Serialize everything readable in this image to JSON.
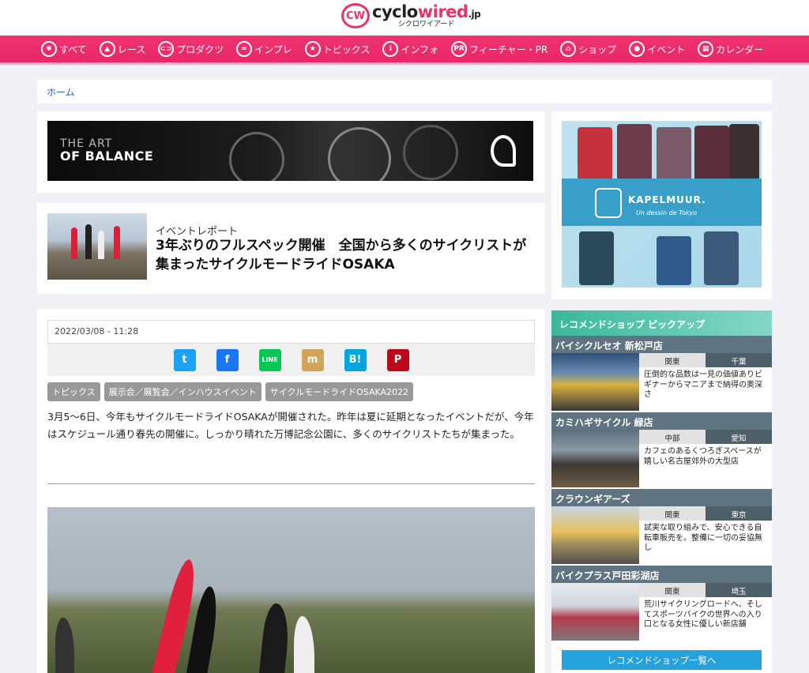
{
  "header": {
    "logo_mark": "CW",
    "logo_pre": "cyclo",
    "logo_accent": "wired",
    "logo_suffix": ".jp",
    "logo_sub": "シクロワイアード"
  },
  "nav": [
    {
      "label": "すべて",
      "icon": "star-icon",
      "glyph": "✱"
    },
    {
      "label": "レース",
      "icon": "race-icon",
      "glyph": "▲"
    },
    {
      "label": "プロダクツ",
      "icon": "products-icon",
      "glyph": "⊂⊃"
    },
    {
      "label": "インプレ",
      "icon": "impression-icon",
      "glyph": "∞"
    },
    {
      "label": "トピックス",
      "icon": "topics-icon",
      "glyph": "★"
    },
    {
      "label": "インフォ",
      "icon": "info-icon",
      "glyph": "i"
    },
    {
      "label": "フィーチャー・PR",
      "icon": "pr-icon",
      "glyph": "PR"
    },
    {
      "label": "ショップ",
      "icon": "shop-icon",
      "glyph": "⌂"
    },
    {
      "label": "イベント",
      "icon": "event-pin-icon",
      "glyph": "●"
    },
    {
      "label": "カレンダー",
      "icon": "calendar-icon",
      "glyph": "▦"
    }
  ],
  "breadcrumb": {
    "home": "ホーム"
  },
  "ad": {
    "line1": "THE ART",
    "line2_prefix": "OF ",
    "line2": "BALANCE"
  },
  "lead": {
    "category": "イベントレポート",
    "title": "3年ぶりのフルスペック開催　全国から多くのサイクリストが集まったサイクルモードライドOSAKA"
  },
  "article": {
    "date": "2022/03/08 - 11:28",
    "share": [
      {
        "name": "twitter-share",
        "glyph": "t",
        "color": "#1da1f2"
      },
      {
        "name": "facebook-share",
        "glyph": "f",
        "color": "#1877f2"
      },
      {
        "name": "line-share",
        "glyph": "LINE",
        "color": "#06c755"
      },
      {
        "name": "mixi-share",
        "glyph": "m",
        "color": "#d1a45c"
      },
      {
        "name": "hatena-share",
        "glyph": "B!",
        "color": "#00a4de"
      },
      {
        "name": "pinterest-share",
        "glyph": "P",
        "color": "#bd081c"
      }
    ],
    "tags": [
      "トピックス",
      "展示会／展覧会／インハウスイベント",
      "サイクルモードライドOSAKA2022"
    ],
    "body": "3月5〜6日、今年もサイクルモードライドOSAKAが開催された。昨年は夏に延期となったイベントだが、今年はスケジュール通り春先の開催に。しっかり晴れた万博記念公園に、多くのサイクリストたちが集まった。"
  },
  "side_ad": {
    "brand": "KAPELMUUR.",
    "tagline": "Un dessin de Tokyo"
  },
  "recommend": {
    "heading": "レコメンドショップ ピックアップ",
    "shops": [
      {
        "name": "バイシクルセオ 新松戸店",
        "region": "関東",
        "pref": "千葉",
        "desc": "圧倒的な品数は一見の価値ありビギナーからマニアまで納得の奥深さ"
      },
      {
        "name": "カミハギサイクル 緑店",
        "region": "中部",
        "pref": "愛知",
        "desc": "カフェのあるくつろぎスペースが嬉しい名古屋郊外の大型店"
      },
      {
        "name": "クラウンギアーズ",
        "region": "関東",
        "pref": "東京",
        "desc": "試実な取り組みで、安心できる自転車販売を。整備に一切の妥協無し"
      },
      {
        "name": "バイクプラス戸田彩湖店",
        "region": "関東",
        "pref": "埼玉",
        "desc": "荒川サイクリングロードへ、そしてスポーツバイクの世界への入り口となる女性に優しい新店舗"
      }
    ],
    "list_button": "レコメンドショップ一覧へ"
  }
}
